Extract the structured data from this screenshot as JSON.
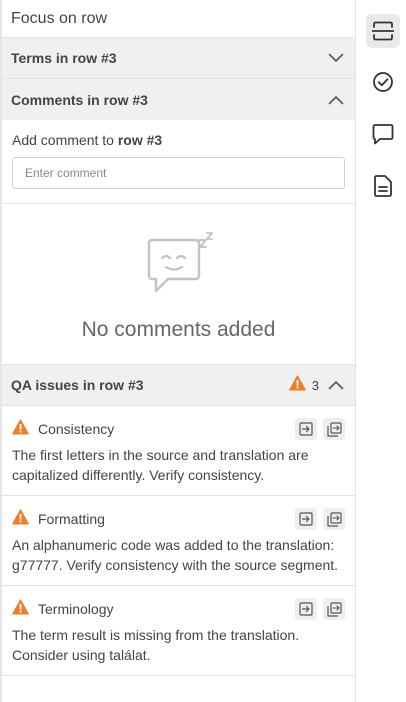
{
  "panel": {
    "focus_title": "Focus on row",
    "terms_header": "Terms in row #3",
    "comments_header": "Comments in row #3",
    "add_comment_prefix": "Add comment to ",
    "add_comment_row": "row #3",
    "comment_placeholder": "Enter comment",
    "empty_text": "No comments added",
    "qa_header": "QA issues in row #3",
    "qa_count": "3"
  },
  "qa_items": [
    {
      "type": "Consistency",
      "description": "The first letters in the source and translation are capitalized differently. Verify consistency."
    },
    {
      "type": "Formatting",
      "description": "An alphanumeric code was added to the translation: g77777. Verify consistency with the source segment."
    },
    {
      "type": "Terminology",
      "description": "The term result is missing from the translation. Consider using találat."
    }
  ],
  "colors": {
    "warning": "#f07d2a",
    "header_bg": "#f0f0f0",
    "active_rail": "#eaeaea"
  },
  "rail": {
    "icons": [
      "focus-row-icon",
      "check-circle-icon",
      "comment-icon",
      "document-icon"
    ],
    "active": "focus-row-icon"
  }
}
